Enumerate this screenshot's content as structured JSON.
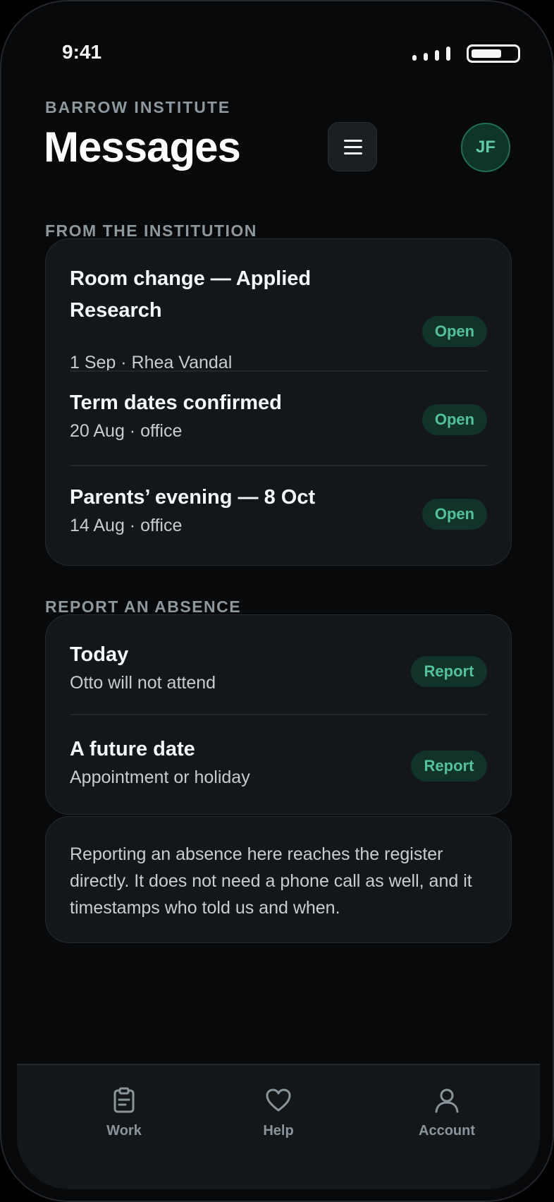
{
  "status_bar": {
    "time": "9:41"
  },
  "header": {
    "org": "BARROW INSTITUTE",
    "title": "Messages",
    "avatar_initials": "JF",
    "menu_icon": "hamburger-menu-icon"
  },
  "messages_section": {
    "label": "FROM THE INSTITUTION",
    "items": [
      {
        "title": "Room change — Applied Research",
        "meta": "1 Sep · Rhea Vandal",
        "action": "Open"
      },
      {
        "title": "Term dates confirmed",
        "meta": "20 Aug · office",
        "action": "Open"
      },
      {
        "title": "Parents’ evening — 8 Oct",
        "meta": "14 Aug · office",
        "action": "Open"
      }
    ]
  },
  "absence_section": {
    "label": "REPORT AN ABSENCE",
    "items": [
      {
        "title": "Today",
        "meta": "Otto will not attend",
        "action": "Report"
      },
      {
        "title": "A future date",
        "meta": "Appointment or holiday",
        "action": "Report"
      }
    ],
    "note": "Reporting an absence here reaches the register directly. It does not need a phone call as well, and it timestamps who told us and when."
  },
  "tab_bar": {
    "tabs": [
      {
        "label": "Work",
        "icon": "clipboard-icon"
      },
      {
        "label": "Help",
        "icon": "heart-icon"
      },
      {
        "label": "Account",
        "icon": "person-icon"
      }
    ]
  },
  "colors": {
    "background": "#08090b",
    "card": "#14171a",
    "accent": "#52c398",
    "accent_bg": "#12332a"
  }
}
